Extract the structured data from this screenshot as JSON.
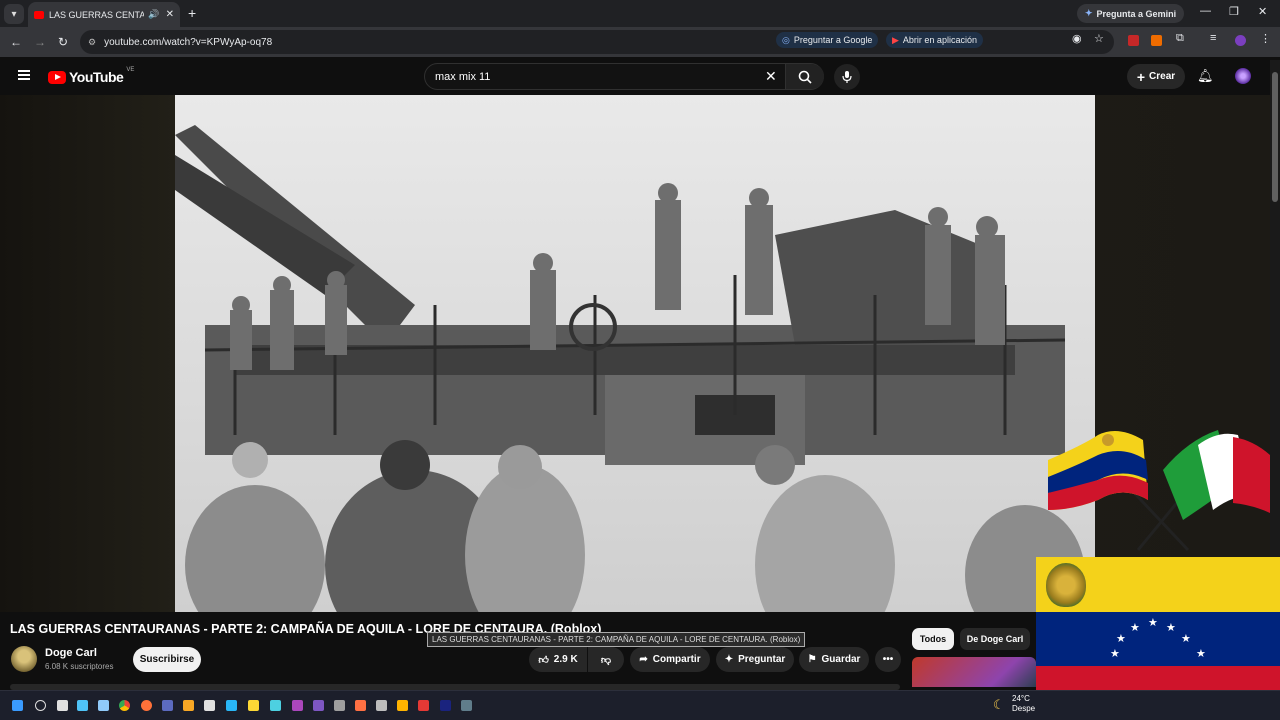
{
  "browser": {
    "tab_title": "LAS GUERRAS CENTAURANAS - PARTE 2",
    "gemini_label": "Pregunta a Gemini",
    "url": "youtube.com/watch?v=KPWyAp-oq78",
    "ask_google_label": "Preguntar a Google",
    "open_app_label": "Abrir en aplicación"
  },
  "header": {
    "logo_text": "YouTube",
    "country_code": "VE",
    "search_value": "max mix 11",
    "create_label": "Crear"
  },
  "video": {
    "title": "LAS GUERRAS CENTAURANAS - PARTE 2: CAMPAÑA DE AQUILA - LORE DE CENTAURA. (Roblox)",
    "tooltip": "LAS GUERRAS CENTAURANAS - PARTE 2: CAMPAÑA DE AQUILA - LORE DE CENTAURA. (Roblox)"
  },
  "channel": {
    "name": "Doge Carl",
    "subscribers": "6.08 K suscriptores",
    "subscribe_label": "Suscribirse"
  },
  "actions": {
    "likes": "2.9 K",
    "share_label": "Compartir",
    "ask_label": "Preguntar",
    "save_label": "Guardar"
  },
  "filters": {
    "all_label": "Todos",
    "from_channel_label": "De Doge Carl"
  },
  "taskbar": {
    "temperature": "24°C",
    "weather_text": "Despe"
  },
  "colors": {
    "brand_red": "#ff0000",
    "flag_yellow": "#f4d21a",
    "flag_blue": "#00247d",
    "flag_red": "#cf142b",
    "italy_green": "#1f9d3a"
  }
}
